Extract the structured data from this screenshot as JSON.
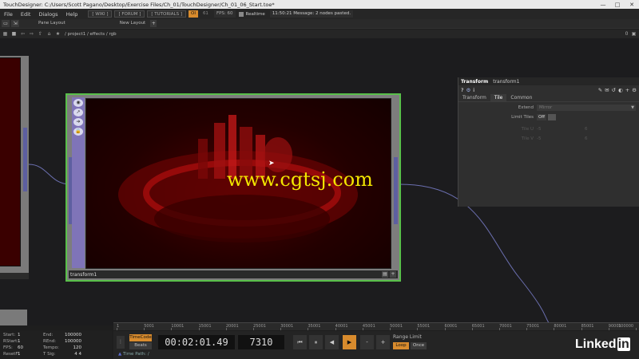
{
  "window": {
    "title": "TouchDesigner: C:/Users/Scott Pagano/Desktop/Exercise Files/Ch_01/TouchDesigner/Ch_01_06_Start.toe*",
    "controls": [
      "—",
      "□",
      "✕"
    ]
  },
  "menubar": {
    "items": [
      "File",
      "Edit",
      "Dialogs",
      "Help"
    ],
    "links": [
      "[ WIKI ]",
      "[ FORUM ]",
      "[ TUTORIALS ]"
    ],
    "badge_o": "OI",
    "badge_num": "61",
    "fps": "FPS: 60",
    "realtime": "Realtime",
    "message": "11:50:21 Message: 2 nodes pasted."
  },
  "panebar": {
    "pane_layout": "Pane Layout",
    "new_layout": "New Layout",
    "plus": "+"
  },
  "pathbar": {
    "path": "/ project1 / effects / rgb",
    "right_a": "0",
    "right_b": "▣"
  },
  "network": {
    "main_node_name": "transform1",
    "watermark": "www.cgtsj.com",
    "colors": {
      "node_border_selected": "#59c04a",
      "connector": "#5d5fa0",
      "tool_strip": "#7f74b8"
    }
  },
  "params": {
    "op_type": "Transform",
    "op_name": "transform1",
    "tabs": [
      "Transform",
      "Tile",
      "Common"
    ],
    "active_tab": "Tile",
    "extend_label": "Extend",
    "extend_value": "Mirror",
    "limit_tiles_label": "Limit Tiles",
    "limit_tiles_value": "Off",
    "tile_u_label": "Tile U",
    "tile_u_a": "-5",
    "tile_u_b": "6",
    "tile_v_label": "Tile V",
    "tile_v_a": "-5",
    "tile_v_b": "6"
  },
  "timeline_info": {
    "rows": [
      {
        "k1": "Start:",
        "v1": "1",
        "k2": "End:",
        "v2": "100000"
      },
      {
        "k1": "RStart:",
        "v1": "1",
        "k2": "REnd:",
        "v2": "100000"
      },
      {
        "k1": "FPS:",
        "v1": "60",
        "k2": "Tempo:",
        "v2": "120"
      },
      {
        "k1": "ResetF:",
        "v1": "1",
        "k2": "T Sig:",
        "v2": "4    4"
      }
    ]
  },
  "ruler": {
    "ticks": [
      "1",
      "5001",
      "10001",
      "15001",
      "20001",
      "25001",
      "30001",
      "35001",
      "40001",
      "45001",
      "50001",
      "55001",
      "60001",
      "65001",
      "70001",
      "75001",
      "80001",
      "85001",
      "90001",
      "100000"
    ]
  },
  "transport": {
    "timecode": "TimeCode",
    "beats": "Beats",
    "time": "00:02:01.49",
    "frame": "7310",
    "buttons": [
      "⏮",
      "⏸",
      "◀",
      "▶",
      "-",
      "+"
    ],
    "range_limit": "Range Limit",
    "loop": "Loop",
    "once": "Once",
    "time_path": "Time Path: /"
  },
  "brand": {
    "name": "Linked",
    "in": "in"
  }
}
